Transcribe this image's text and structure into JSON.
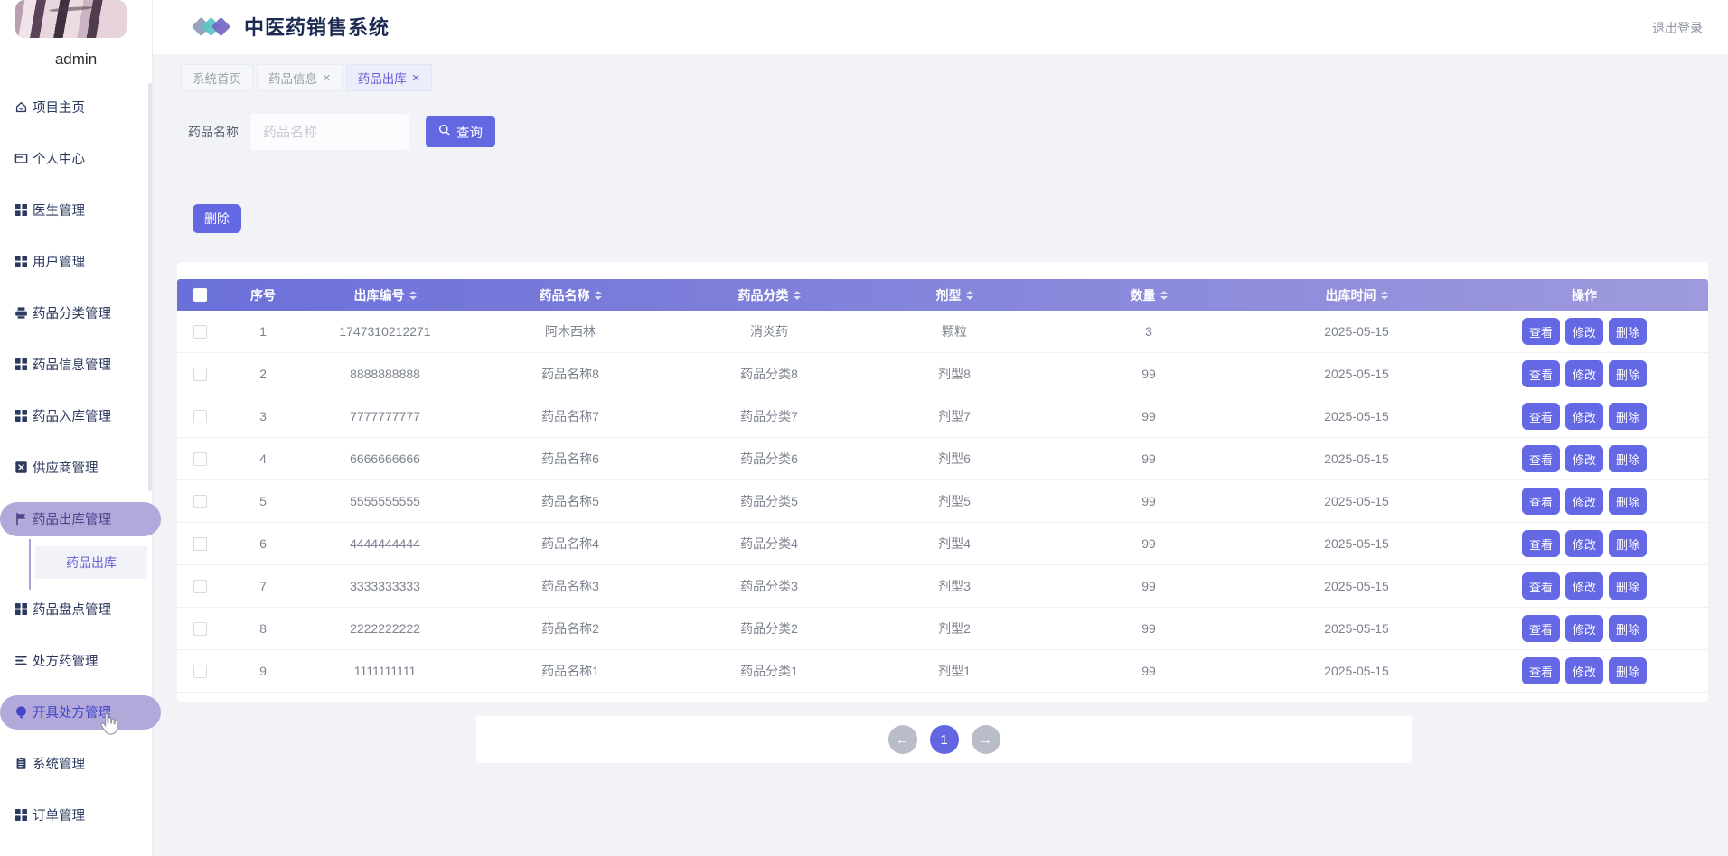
{
  "header": {
    "title": "中医药销售系统",
    "logout_label": "退出登录",
    "logo_colors": [
      "#8d9cb8",
      "#59c7c3",
      "#7466c3"
    ]
  },
  "user": {
    "name": "admin"
  },
  "sidebar": {
    "items": [
      {
        "label": "项目主页",
        "icon": "home-icon"
      },
      {
        "label": "个人中心",
        "icon": "card-icon"
      },
      {
        "label": "医生管理",
        "icon": "grid-icon"
      },
      {
        "label": "用户管理",
        "icon": "grid-icon"
      },
      {
        "label": "药品分类管理",
        "icon": "printer-icon"
      },
      {
        "label": "药品信息管理",
        "icon": "grid-icon"
      },
      {
        "label": "药品入库管理",
        "icon": "grid-icon"
      },
      {
        "label": "供应商管理",
        "icon": "box-x-icon"
      },
      {
        "label": "药品出库管理",
        "icon": "flag-icon",
        "active": true,
        "variant": "purple",
        "children": [
          {
            "label": "药品出库",
            "active": true
          }
        ]
      },
      {
        "label": "药品盘点管理",
        "icon": "grid-icon"
      },
      {
        "label": "处方药管理",
        "icon": "list-icon"
      },
      {
        "label": "开具处方管理",
        "icon": "bulb-icon",
        "active": true,
        "variant": "blue",
        "cursor": true
      },
      {
        "label": "系统管理",
        "icon": "clipboard-icon"
      },
      {
        "label": "订单管理",
        "icon": "grid-icon"
      }
    ]
  },
  "tabs": [
    {
      "label": "系统首页",
      "closable": false,
      "active": false
    },
    {
      "label": "药品信息",
      "closable": true,
      "active": false
    },
    {
      "label": "药品出库",
      "closable": true,
      "active": true
    }
  ],
  "search": {
    "label": "药品名称",
    "placeholder": "药品名称",
    "value": "",
    "button_label": "查询",
    "button_icon": "search-icon"
  },
  "toolbar": {
    "delete_label": "删除"
  },
  "table": {
    "columns": [
      {
        "label": "序号",
        "sortable": false
      },
      {
        "label": "出库编号",
        "sortable": true
      },
      {
        "label": "药品名称",
        "sortable": true
      },
      {
        "label": "药品分类",
        "sortable": true
      },
      {
        "label": "剂型",
        "sortable": true
      },
      {
        "label": "数量",
        "sortable": true
      },
      {
        "label": "出库时间",
        "sortable": true
      },
      {
        "label": "操作",
        "sortable": false
      }
    ],
    "rows": [
      {
        "index": "1",
        "code": "1747310212271",
        "name": "阿木西林",
        "category": "消炎药",
        "form": "颗粒",
        "qty": "3",
        "date": "2025-05-15"
      },
      {
        "index": "2",
        "code": "8888888888",
        "name": "药品名称8",
        "category": "药品分类8",
        "form": "剂型8",
        "qty": "99",
        "date": "2025-05-15"
      },
      {
        "index": "3",
        "code": "7777777777",
        "name": "药品名称7",
        "category": "药品分类7",
        "form": "剂型7",
        "qty": "99",
        "date": "2025-05-15"
      },
      {
        "index": "4",
        "code": "6666666666",
        "name": "药品名称6",
        "category": "药品分类6",
        "form": "剂型6",
        "qty": "99",
        "date": "2025-05-15"
      },
      {
        "index": "5",
        "code": "5555555555",
        "name": "药品名称5",
        "category": "药品分类5",
        "form": "剂型5",
        "qty": "99",
        "date": "2025-05-15"
      },
      {
        "index": "6",
        "code": "4444444444",
        "name": "药品名称4",
        "category": "药品分类4",
        "form": "剂型4",
        "qty": "99",
        "date": "2025-05-15"
      },
      {
        "index": "7",
        "code": "3333333333",
        "name": "药品名称3",
        "category": "药品分类3",
        "form": "剂型3",
        "qty": "99",
        "date": "2025-05-15"
      },
      {
        "index": "8",
        "code": "2222222222",
        "name": "药品名称2",
        "category": "药品分类2",
        "form": "剂型2",
        "qty": "99",
        "date": "2025-05-15"
      },
      {
        "index": "9",
        "code": "1111111111",
        "name": "药品名称1",
        "category": "药品分类1",
        "form": "剂型1",
        "qty": "99",
        "date": "2025-05-15"
      }
    ],
    "action_labels": [
      "查看",
      "修改",
      "删除"
    ]
  },
  "pagination": {
    "current": "1",
    "prev_icon": "arrow-left-icon",
    "next_icon": "arrow-right-icon"
  }
}
